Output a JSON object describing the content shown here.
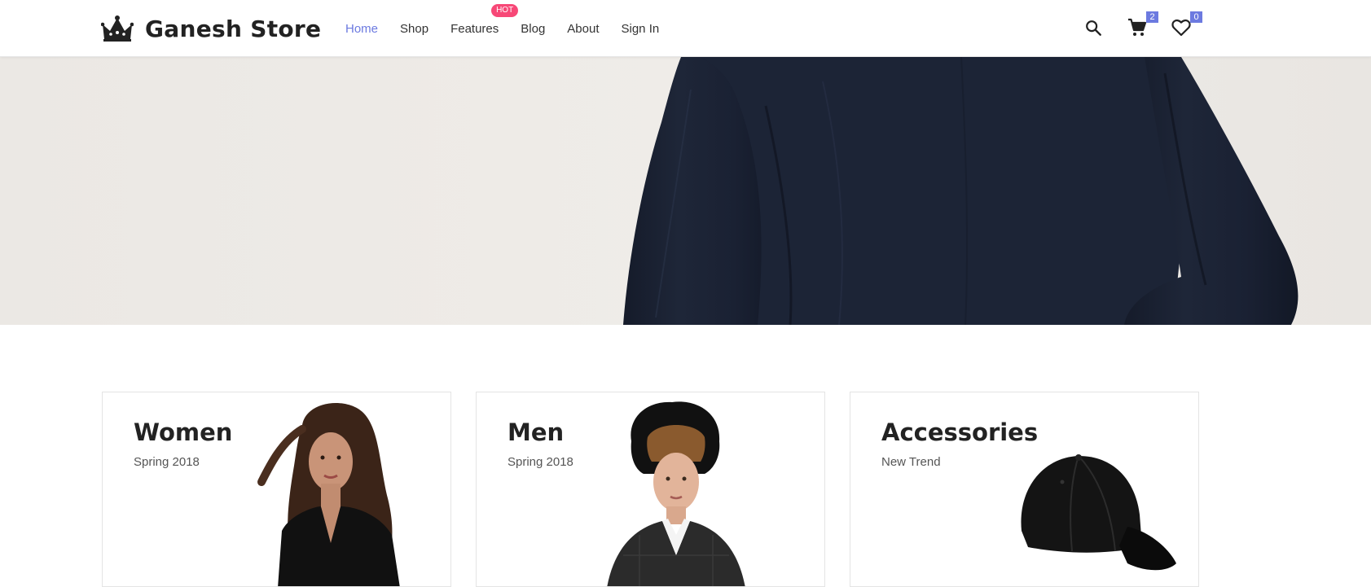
{
  "brand": {
    "name": "Ganesh Store",
    "logo_icon": "crown-icon"
  },
  "nav": {
    "items": [
      {
        "label": "Home",
        "active": true
      },
      {
        "label": "Shop",
        "active": false
      },
      {
        "label": "Features",
        "active": false,
        "badge": "HOT"
      },
      {
        "label": "Blog",
        "active": false
      },
      {
        "label": "About",
        "active": false
      },
      {
        "label": "Sign In",
        "active": false
      }
    ]
  },
  "header_icons": {
    "search": {
      "icon": "search-icon"
    },
    "cart": {
      "icon": "cart-icon",
      "count": "2"
    },
    "wishlist": {
      "icon": "heart-icon",
      "count": "0"
    }
  },
  "hero": {
    "image": "model-navy-jacket"
  },
  "categories": [
    {
      "title": "Women",
      "subtitle": "Spring 2018",
      "image": "woman-black-dress"
    },
    {
      "title": "Men",
      "subtitle": "Spring 2018",
      "image": "man-hat-blazer"
    },
    {
      "title": "Accessories",
      "subtitle": "New Trend",
      "image": "black-cap"
    }
  ],
  "colors": {
    "accent": "#6c7ae0",
    "hot_badge": "#f74877",
    "hero_bg": "#ece9e5",
    "jacket": "#1b2233"
  }
}
